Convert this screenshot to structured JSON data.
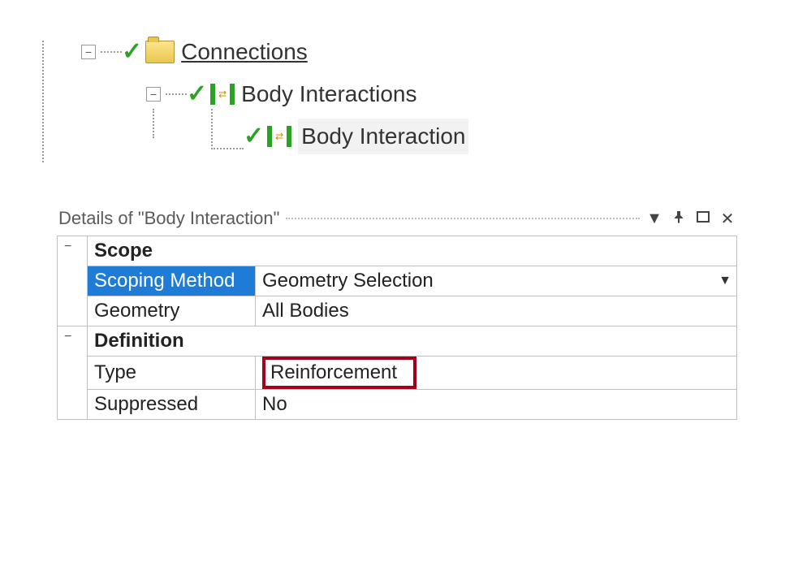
{
  "tree": {
    "connections": {
      "label": "Connections"
    },
    "body_interactions": {
      "label": "Body Interactions"
    },
    "body_interaction": {
      "label": "Body Interaction"
    }
  },
  "details": {
    "title": "Details of \"Body Interaction\"",
    "groups": {
      "scope": {
        "header": "Scope",
        "scoping_method": {
          "label": "Scoping Method",
          "value": "Geometry Selection"
        },
        "geometry": {
          "label": "Geometry",
          "value": "All Bodies"
        }
      },
      "definition": {
        "header": "Definition",
        "type": {
          "label": "Type",
          "value": "Reinforcement"
        },
        "suppressed": {
          "label": "Suppressed",
          "value": "No"
        }
      }
    }
  },
  "glyphs": {
    "minus": "−",
    "dropdown": "▼",
    "pin": "📌",
    "max": "☐",
    "close": "✕"
  }
}
